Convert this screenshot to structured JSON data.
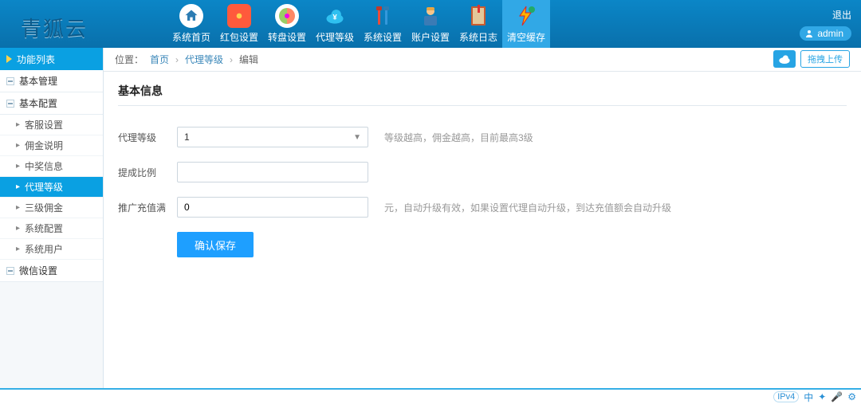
{
  "brand": "青狐云",
  "topnav": [
    {
      "label": "系统首页",
      "name": "nav-home"
    },
    {
      "label": "红包设置",
      "name": "nav-redpacket"
    },
    {
      "label": "转盘设置",
      "name": "nav-wheel"
    },
    {
      "label": "代理等级",
      "name": "nav-agent"
    },
    {
      "label": "系统设置",
      "name": "nav-settings"
    },
    {
      "label": "账户设置",
      "name": "nav-account"
    },
    {
      "label": "系统日志",
      "name": "nav-logs"
    },
    {
      "label": "清空缓存",
      "name": "nav-clearcache"
    }
  ],
  "topnav_active_index": 7,
  "logout_label": "退出",
  "admin_label": "admin",
  "sidebar": {
    "title": "功能列表",
    "groups": [
      {
        "label": "基本管理",
        "expanded": false,
        "items": []
      },
      {
        "label": "基本配置",
        "expanded": true,
        "items": [
          {
            "label": "客服设置"
          },
          {
            "label": "佣金说明"
          },
          {
            "label": "中奖信息"
          },
          {
            "label": "代理等级",
            "active": true
          },
          {
            "label": "三级佣金"
          },
          {
            "label": "系统配置"
          },
          {
            "label": "系统用户"
          }
        ]
      },
      {
        "label": "微信设置",
        "expanded": false,
        "items": []
      }
    ]
  },
  "breadcrumb": {
    "prefix": "位置：",
    "parts": [
      "首页",
      "代理等级",
      "编辑"
    ]
  },
  "upload": {
    "label": "拖拽上传"
  },
  "panel": {
    "title": "基本信息",
    "fields": {
      "level": {
        "label": "代理等级",
        "value": "1",
        "hint": "等级越高，佣金越高，目前最高3级"
      },
      "ratio": {
        "label": "提成比例",
        "value": ""
      },
      "recharge": {
        "label": "推广充值满",
        "value": "0",
        "hint": "元，自动升级有效，如果设置代理自动升级，到达充值额会自动升级"
      }
    },
    "submit": "确认保存"
  },
  "bottombar": {
    "badge": "IPv4",
    "items": [
      "中",
      "✦",
      "🎤",
      "⚙"
    ]
  }
}
